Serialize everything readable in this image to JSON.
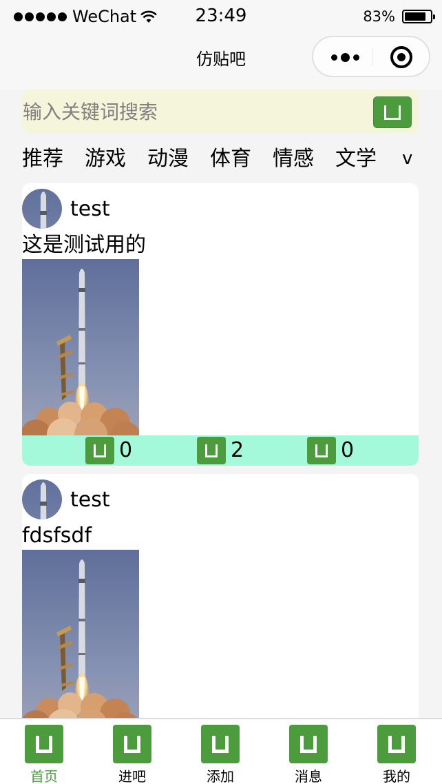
{
  "status_bar": {
    "carrier": "WeChat",
    "time": "23:49",
    "battery_percent": "83%",
    "battery_level": 0.83
  },
  "nav": {
    "title": "仿贴吧"
  },
  "search": {
    "placeholder": "输入关键词搜索",
    "value": ""
  },
  "categories": {
    "items": [
      "推荐",
      "游戏",
      "动漫",
      "体育",
      "情感",
      "文学"
    ],
    "more": "v"
  },
  "posts": [
    {
      "username": "test",
      "text": "这是测试用的",
      "actions": [
        "0",
        "2",
        "0"
      ]
    },
    {
      "username": "test",
      "text": "fdsfsdf"
    }
  ],
  "tabs": [
    {
      "label": "首页",
      "active": true
    },
    {
      "label": "进吧",
      "active": false
    },
    {
      "label": "添加",
      "active": false
    },
    {
      "label": "消息",
      "active": false
    },
    {
      "label": "我的",
      "active": false
    }
  ],
  "colors": {
    "accent": "#4c9b3d",
    "search_bg": "#f5f5dc",
    "action_bar_bg": "#a3f9d9"
  }
}
